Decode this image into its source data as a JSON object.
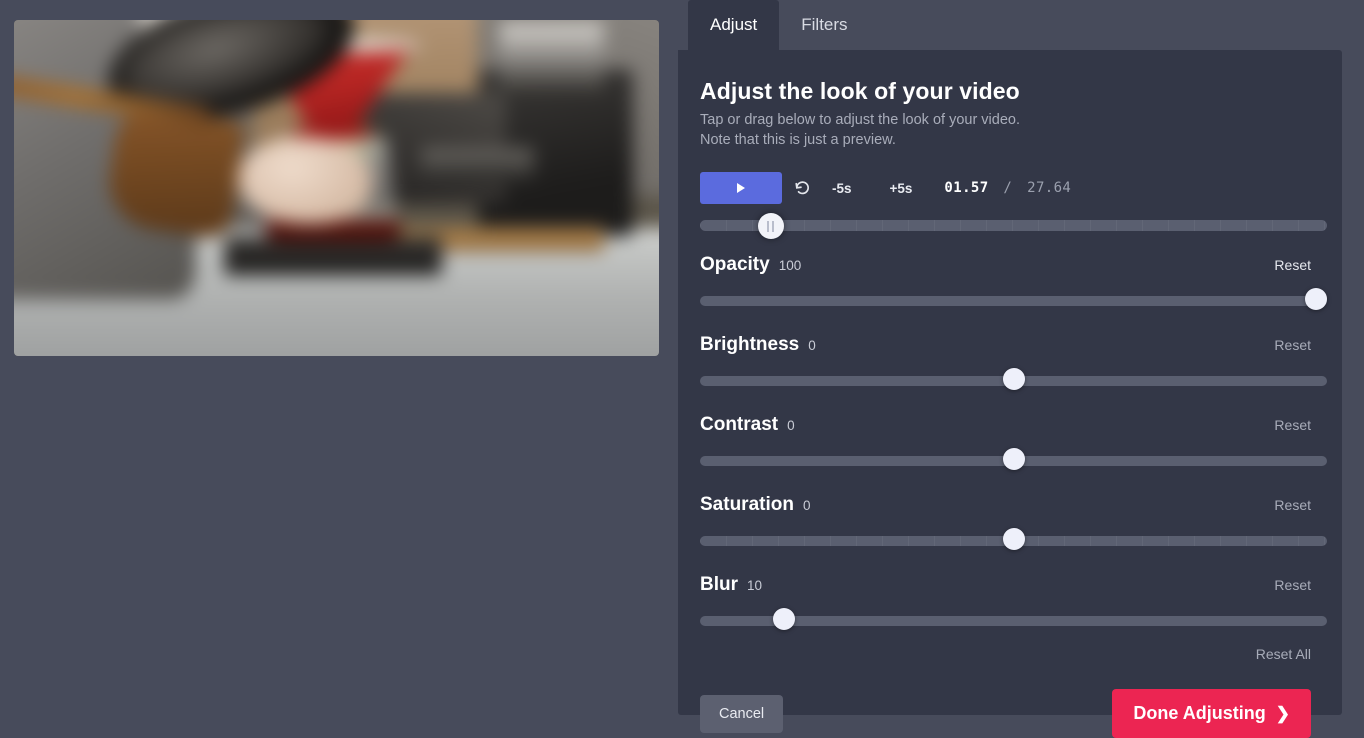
{
  "tabs": [
    {
      "label": "Adjust",
      "active": true
    },
    {
      "label": "Filters",
      "active": false
    }
  ],
  "panel": {
    "title": "Adjust the look of your video",
    "subtitle_line1": "Tap or drag below to adjust the look of your video.",
    "subtitle_line2": "Note that this is just a preview."
  },
  "playback": {
    "play_label": "play-icon",
    "restart_label": "restart-icon",
    "back5_label": "-5s",
    "forward5_label": "+5s",
    "current_time": "01.57",
    "separator": "/",
    "total_time": "27.64",
    "scrub_percent": 6
  },
  "sliders": [
    {
      "label": "Opacity",
      "value": "100",
      "reset_label": "Reset",
      "percent": 100,
      "ticks": false,
      "reset_bright": true
    },
    {
      "label": "Brightness",
      "value": "0",
      "reset_label": "Reset",
      "percent": 50,
      "ticks": false,
      "reset_bright": false
    },
    {
      "label": "Contrast",
      "value": "0",
      "reset_label": "Reset",
      "percent": 50,
      "ticks": false,
      "reset_bright": false
    },
    {
      "label": "Saturation",
      "value": "0",
      "reset_label": "Reset",
      "percent": 50,
      "ticks": true,
      "reset_bright": false
    },
    {
      "label": "Blur",
      "value": "10",
      "reset_label": "Reset",
      "percent": 12,
      "ticks": false,
      "reset_bright": false
    }
  ],
  "footer": {
    "reset_all_label": "Reset All",
    "cancel_label": "Cancel",
    "done_label": "Done Adjusting",
    "done_chevron": "❯"
  },
  "colors": {
    "page_background": "#474b5b",
    "panel_background": "#333747",
    "accent_play": "#5b6bde",
    "accent_done": "#ec2552",
    "cancel_grey": "#5c6070",
    "track_grey": "#5a5f70",
    "handle_white": "#eef0fa"
  },
  "preview": {
    "description": "blurred video frame of a barista pouring a red pour-over coffee dripper"
  }
}
